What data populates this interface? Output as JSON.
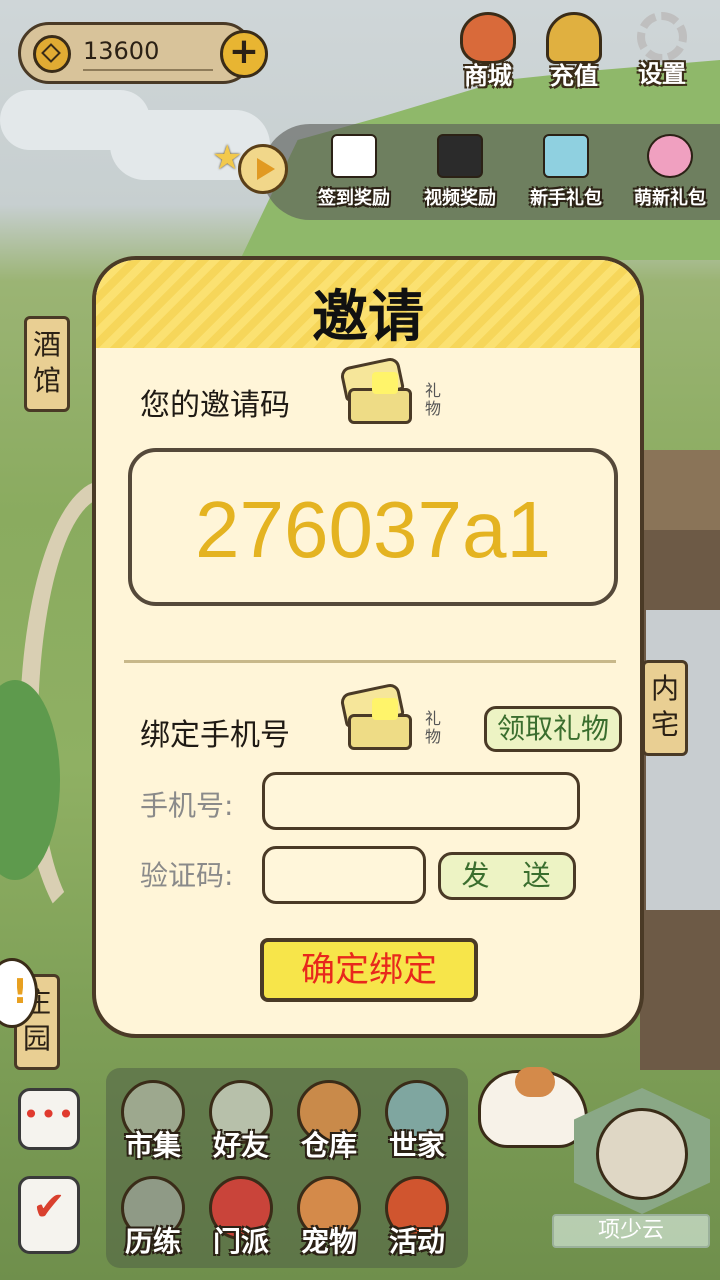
{
  "currency": {
    "amount": "13600",
    "add_icon": "plus-icon",
    "coin_icon": "coin-icon"
  },
  "top_menu": [
    {
      "label": "商城",
      "icon": "shop-bag-icon",
      "color": "#d96a3a"
    },
    {
      "label": "充值",
      "icon": "gold-ingot-icon",
      "color": "#e0b040"
    },
    {
      "label": "设置",
      "icon": "gear-icon",
      "color": "#bfbfbf"
    }
  ],
  "reward_strip": [
    {
      "label": "签到奖励",
      "icon": "calendar-icon",
      "color": "#ffffff"
    },
    {
      "label": "视频奖励",
      "icon": "clapperboard-icon",
      "color": "#2b2b2b"
    },
    {
      "label": "新手礼包",
      "icon": "chest-icon",
      "color": "#8fd0e0"
    },
    {
      "label": "萌新礼包",
      "icon": "mascot-icon",
      "color": "#f0a0c0"
    }
  ],
  "side_signs": {
    "left_top": "酒馆",
    "right_mid": "内宅",
    "left_bottom": "庄园"
  },
  "dialog": {
    "title": "邀请",
    "invite_label": "您的邀请码",
    "gift_tag": "礼物",
    "invite_code": "276037a1",
    "bind_label": "绑定手机号",
    "claim_button": "领取礼物",
    "phone_label": "手机号:",
    "phone_value": "",
    "code_label": "验证码:",
    "code_value": "",
    "send_button": "发 送",
    "confirm_button": "确定绑定"
  },
  "bottom_menu": [
    {
      "label": "市集",
      "icon": "market-icon",
      "color": "#9da88e"
    },
    {
      "label": "好友",
      "icon": "handshake-icon",
      "color": "#b7c0aa"
    },
    {
      "label": "仓库",
      "icon": "treasure-chest-icon",
      "color": "#c98a4a"
    },
    {
      "label": "世家",
      "icon": "vase-icon",
      "color": "#7fa6a0"
    },
    {
      "label": "历练",
      "icon": "weapons-icon",
      "color": "#8f9a86"
    },
    {
      "label": "门派",
      "icon": "banner-icon",
      "color": "#c9443a"
    },
    {
      "label": "宠物",
      "icon": "paw-icon",
      "color": "#d48a4a"
    },
    {
      "label": "活动",
      "icon": "lantern-icon",
      "color": "#d0552f"
    }
  ],
  "player": {
    "name": "项少云"
  }
}
